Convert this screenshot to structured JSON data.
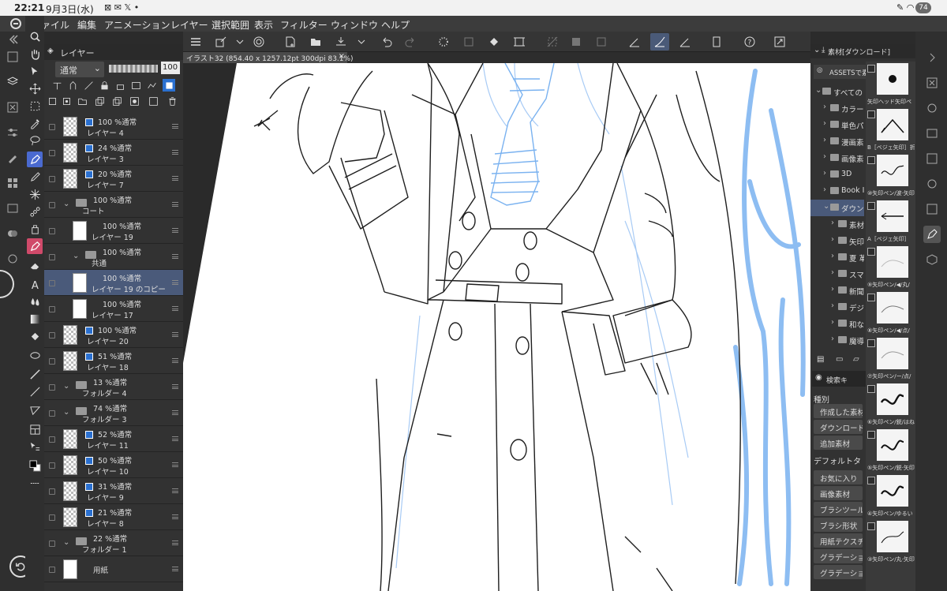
{
  "status_bar": {
    "time": "22:21",
    "date": "9月3日(水)",
    "battery": "74"
  },
  "menu": {
    "items": [
      "ファイル",
      "編集",
      "アニメーション",
      "レイヤー",
      "選択範囲",
      "表示",
      "フィルター",
      "ウィンドウ",
      "ヘルプ"
    ]
  },
  "canvas_tab": {
    "title": "イラスト32 (854.40 x 1257.12pt 300dpi 83.1%)",
    "close": "×"
  },
  "layer_panel": {
    "title": "レイヤー",
    "blend_mode": "通常",
    "opacity": "100",
    "layers": [
      {
        "pct": "100 %通常",
        "name": "レイヤー 4",
        "indent": 0,
        "type": "layer",
        "selected": false
      },
      {
        "pct": "24 %通常",
        "name": "レイヤー 3",
        "indent": 0,
        "type": "layer",
        "selected": false
      },
      {
        "pct": "20 %通常",
        "name": "レイヤー 7",
        "indent": 0,
        "type": "layer",
        "selected": false
      },
      {
        "pct": "100 %通常",
        "name": "コート",
        "indent": 0,
        "type": "folder",
        "selected": false
      },
      {
        "pct": "100 %通常",
        "name": "レイヤー 19",
        "indent": 1,
        "type": "layer",
        "selected": false
      },
      {
        "pct": "100 %通常",
        "name": "共通",
        "indent": 1,
        "type": "folder",
        "selected": false
      },
      {
        "pct": "100 %通常",
        "name": "レイヤー 19 のコピー",
        "indent": 1,
        "type": "layer",
        "selected": true
      },
      {
        "pct": "100 %通常",
        "name": "レイヤー 17",
        "indent": 1,
        "type": "layer",
        "selected": false
      },
      {
        "pct": "100 %通常",
        "name": "レイヤー 20",
        "indent": 0,
        "type": "layer",
        "selected": false
      },
      {
        "pct": "51 %通常",
        "name": "レイヤー 18",
        "indent": 0,
        "type": "layer",
        "selected": false
      },
      {
        "pct": "13 %通常",
        "name": "フォルダー 4",
        "indent": 0,
        "type": "folder",
        "selected": false
      },
      {
        "pct": "74 %通常",
        "name": "フォルダー 3",
        "indent": 0,
        "type": "folder",
        "selected": false
      },
      {
        "pct": "52 %通常",
        "name": "レイヤー 11",
        "indent": 0,
        "type": "layer",
        "selected": false
      },
      {
        "pct": "50 %通常",
        "name": "レイヤー 10",
        "indent": 0,
        "type": "layer",
        "selected": false
      },
      {
        "pct": "31 %通常",
        "name": "レイヤー 9",
        "indent": 0,
        "type": "layer",
        "selected": false
      },
      {
        "pct": "21 %通常",
        "name": "レイヤー 8",
        "indent": 0,
        "type": "layer",
        "selected": false
      },
      {
        "pct": "22 %通常",
        "name": "フォルダー 1",
        "indent": 0,
        "type": "folder",
        "selected": false
      },
      {
        "pct": "",
        "name": "用紙",
        "indent": 0,
        "type": "paper",
        "selected": false
      }
    ]
  },
  "material_panel": {
    "title": "素材[ダウンロード]",
    "assets_label": "ASSETSで素",
    "tree": [
      {
        "label": "すべての",
        "level": 0,
        "open": true,
        "selected": false
      },
      {
        "label": "カラー",
        "level": 1,
        "open": false,
        "selected": false
      },
      {
        "label": "単色パ",
        "level": 1,
        "open": false,
        "selected": false
      },
      {
        "label": "漫画素",
        "level": 1,
        "open": false,
        "selected": false
      },
      {
        "label": "画像素",
        "level": 1,
        "open": false,
        "selected": false
      },
      {
        "label": "3D",
        "level": 1,
        "open": false,
        "selected": false
      },
      {
        "label": "Book I",
        "level": 1,
        "open": false,
        "selected": false
      },
      {
        "label": "ダウン",
        "level": 1,
        "open": true,
        "selected": true
      },
      {
        "label": "素材",
        "level": 2,
        "open": false,
        "selected": false
      },
      {
        "label": "矢印",
        "level": 2,
        "open": false,
        "selected": false
      },
      {
        "label": "夏 革",
        "level": 2,
        "open": false,
        "selected": false
      },
      {
        "label": "スマ",
        "level": 2,
        "open": false,
        "selected": false
      },
      {
        "label": "新聞",
        "level": 2,
        "open": false,
        "selected": false
      },
      {
        "label": "デジ",
        "level": 2,
        "open": false,
        "selected": false
      },
      {
        "label": "和な",
        "level": 2,
        "open": false,
        "selected": false
      },
      {
        "label": "魔導",
        "level": 2,
        "open": false,
        "selected": false
      }
    ],
    "search_placeholder": "検索キ",
    "kind_label": "種別",
    "buttons": [
      "作成した素材",
      "ダウンロード",
      "追加素材"
    ],
    "default_label": "デフォルトタ",
    "buttons2": [
      "お気に入り",
      "画像素材",
      "ブラシツール",
      "ブラシ形状",
      "用紙テクスチ",
      "グラデーショ",
      "グラデーショ"
    ],
    "thumbs": [
      {
        "caption": "矢印ヘッド矢印ペ"
      },
      {
        "caption": "B［ベジェ矢印］折"
      },
      {
        "caption": "⑩矢印ペン/波·矢印"
      },
      {
        "caption": "A［ベジェ矢印］"
      },
      {
        "caption": "⑨矢印ペン/◀/丸/"
      },
      {
        "caption": "⑧矢印ペン/◀/点/"
      },
      {
        "caption": "⑦矢印ペン/ー/点/"
      },
      {
        "caption": "⑥矢印ペン/鋭/はね"
      },
      {
        "caption": "⑤矢印ペン/鋭·矢印"
      },
      {
        "caption": "④矢印ペン/ゆるい"
      },
      {
        "caption": "③矢印ペン/丸·矢印"
      }
    ]
  },
  "colors": {
    "accent": "#4a6ad0",
    "selection": "#4a5a7a",
    "sketch_blue": "#7ab2f0"
  }
}
